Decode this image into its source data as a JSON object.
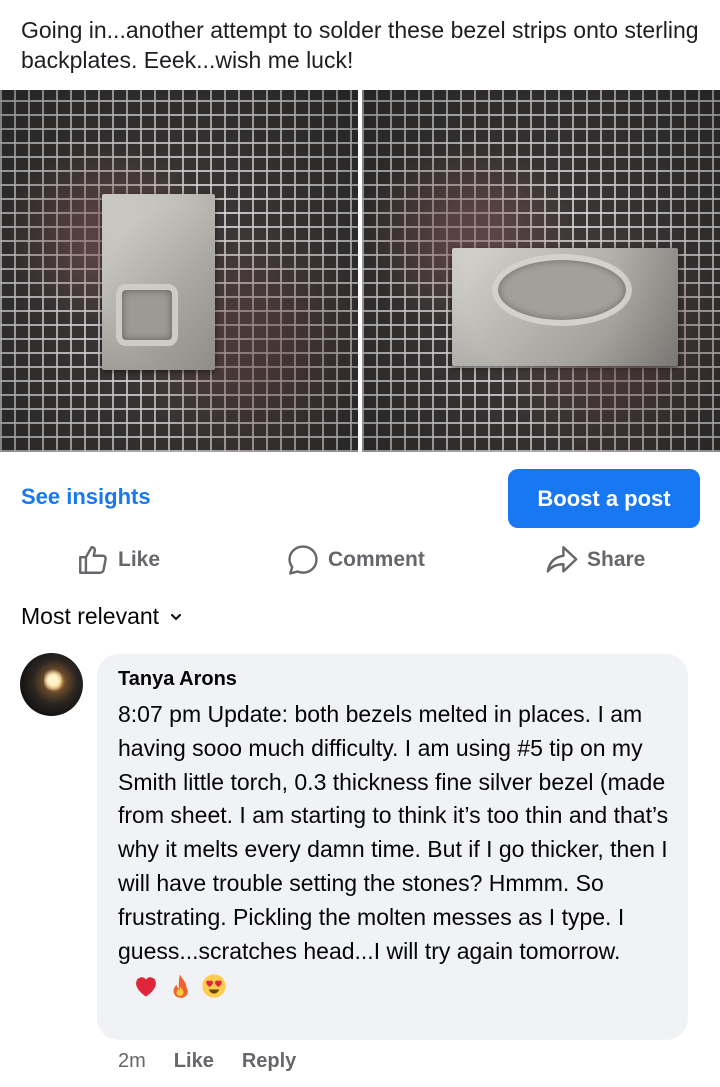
{
  "post": {
    "text": "Going in...another attempt to solder these bezel strips onto sterling backplates.  Eeek...wish me luck!"
  },
  "photos": [
    {
      "icon": "photo-square-bezel-icon"
    },
    {
      "icon": "photo-oval-bezel-icon"
    }
  ],
  "insights_label": "See insights",
  "boost_label": "Boost a post",
  "actions": {
    "like": "Like",
    "comment": "Comment",
    "share": "Share"
  },
  "sort_label": "Most relevant",
  "comment": {
    "author": "Tanya Arons",
    "text": "8:07 pm Update: both bezels melted in places. I am having sooo much difficulty.  I am using #5 tip on my Smith little torch, 0.3 thickness fine silver bezel (made from sheet.  I am starting to think it’s too thin and that’s why it melts every damn time.  But if I go thicker, then I will have trouble setting the stones? Hmmm.  So frustrating.  Pickling the molten messes as I type.  I guess...scratches head...I will try again tomorrow.",
    "emoji": [
      "heart-icon",
      "fire-icon",
      "heart-eyes-icon"
    ],
    "time": "2m",
    "like": "Like",
    "reply": "Reply"
  },
  "colors": {
    "accent": "#1877f2",
    "muted": "#65676b",
    "bubble": "#f0f2f5"
  }
}
